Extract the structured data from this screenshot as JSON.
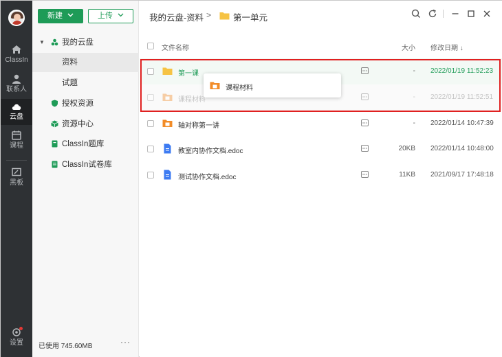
{
  "nav_rail": {
    "items": [
      {
        "label": "ClassIn",
        "icon": "home-icon"
      },
      {
        "label": "联系人",
        "icon": "contacts-icon"
      },
      {
        "label": "云盘",
        "icon": "cloud-icon",
        "active": true
      },
      {
        "label": "课程",
        "icon": "calendar-icon"
      },
      {
        "label": "黑板",
        "icon": "blackboard-icon"
      }
    ],
    "settings_label": "设置"
  },
  "sidebar": {
    "new_label": "新建",
    "upload_label": "上传",
    "tree": [
      {
        "label": "我的云盘",
        "icon": "cloud-drive-icon"
      },
      {
        "label": "资料",
        "selected": true
      },
      {
        "label": "试题"
      },
      {
        "label": "授权资源",
        "icon": "shield-icon"
      },
      {
        "label": "资源中心",
        "icon": "cube-icon"
      },
      {
        "label": "ClassIn题库",
        "icon": "book-icon"
      },
      {
        "label": "ClassIn试卷库",
        "icon": "paper-icon"
      }
    ],
    "usage": "已使用 745.60MB",
    "more": "···"
  },
  "main": {
    "breadcrumb": {
      "root": "我的云盘-资料",
      "separator": ">",
      "current": "第一单元"
    },
    "columns": {
      "name": "文件名称",
      "size": "大小",
      "date": "修改日期 ↓"
    },
    "rows": [
      {
        "name": "第一课",
        "type": "folder",
        "size": "-",
        "date": "2022/01/19 11:52:23",
        "state": "highlighted"
      },
      {
        "name": "课程材料",
        "type": "folder-doc",
        "size": "-",
        "date": "2022/01/19 11:52:51",
        "state": "dragging"
      },
      {
        "name": "轴对称第一讲",
        "type": "folder-doc",
        "size": "-",
        "date": "2022/01/14 10:47:39"
      },
      {
        "name": "教室内协作文档.edoc",
        "type": "edoc",
        "size": "20KB",
        "date": "2022/01/14 10:48:00"
      },
      {
        "name": "测试协作文档.edoc",
        "type": "edoc",
        "size": "11KB",
        "date": "2021/09/17 17:48:18"
      }
    ],
    "drag_preview": {
      "label": "课程材料"
    }
  },
  "colors": {
    "brand": "#1e9b57",
    "highlight_border": "#e02020",
    "rail": "#2e3134",
    "folder": "#f6c344",
    "folder_doc": "#f28c28",
    "edoc": "#3d7bf2"
  }
}
